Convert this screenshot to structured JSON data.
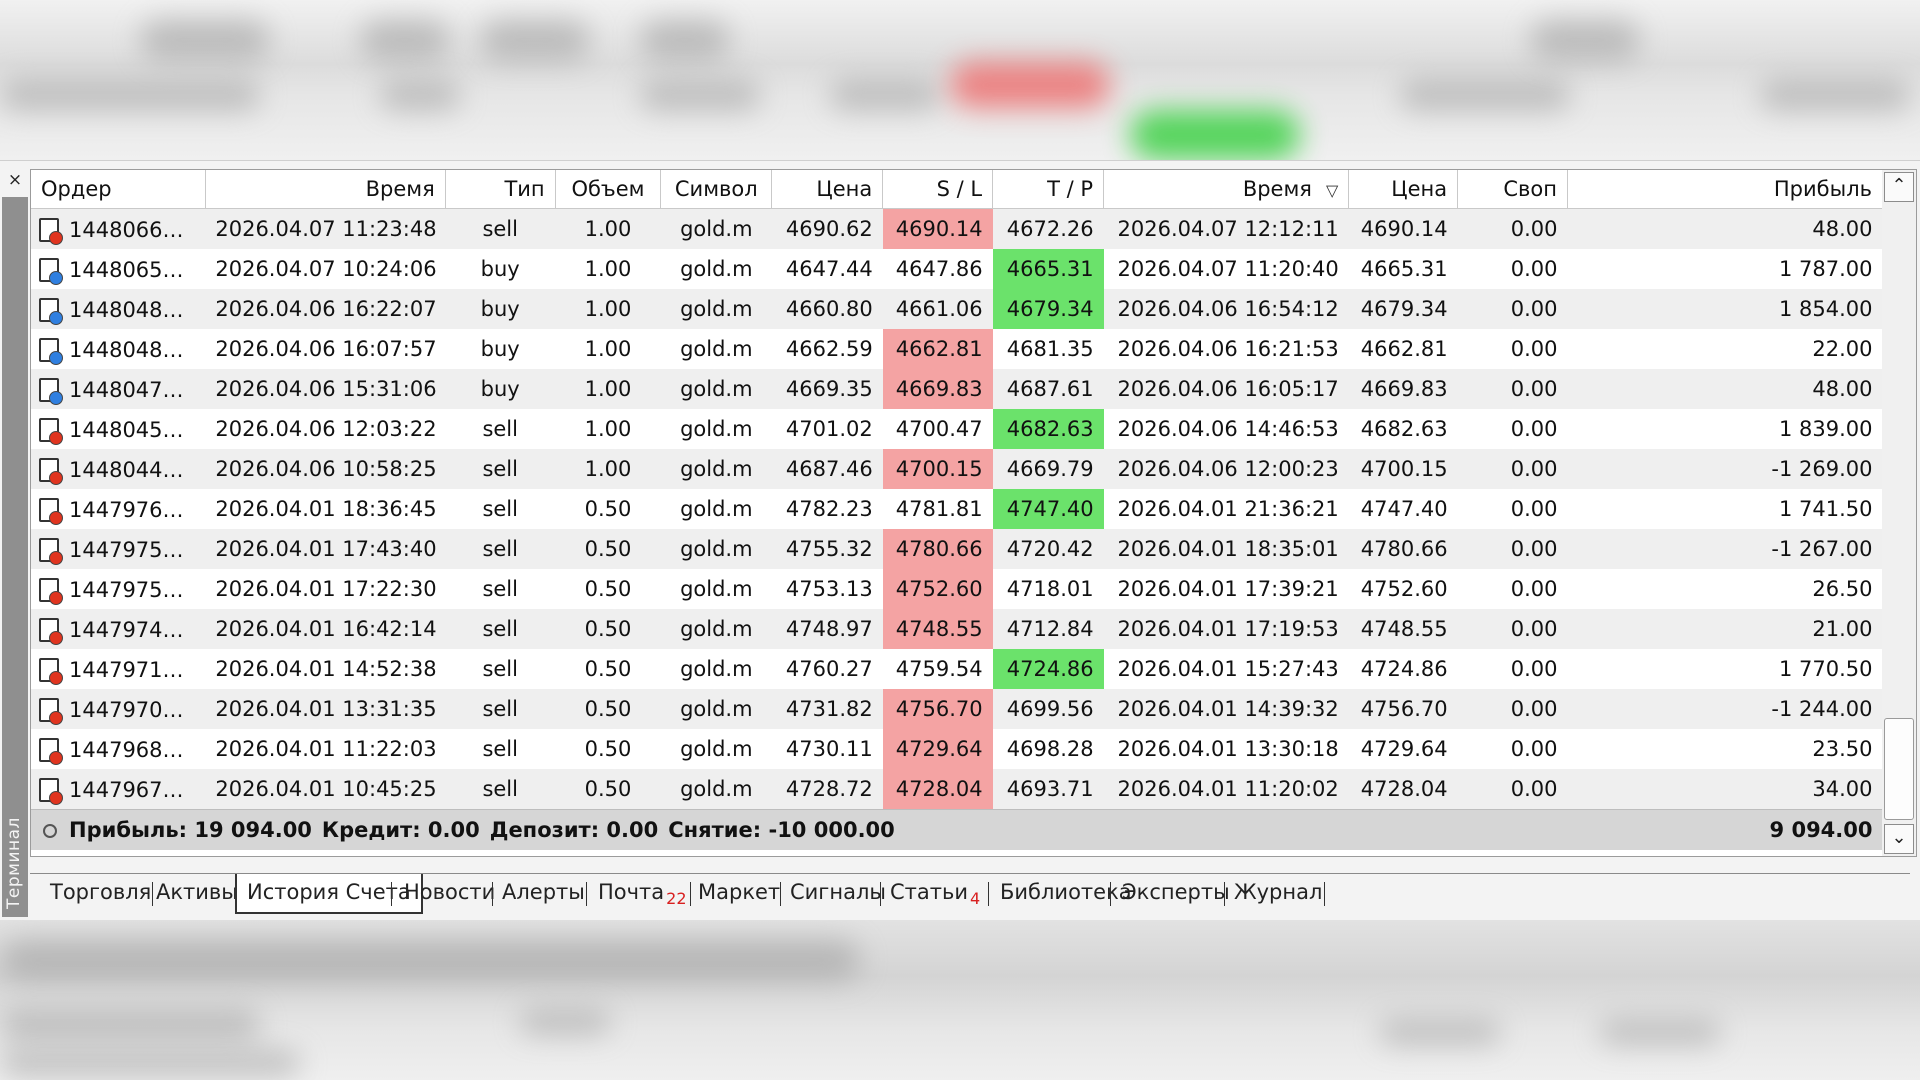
{
  "terminal": {
    "title": "Терминал",
    "close_glyph": "×"
  },
  "columns": [
    {
      "key": "order",
      "label": "Ордер"
    },
    {
      "key": "open_time",
      "label": "Время"
    },
    {
      "key": "type",
      "label": "Тип"
    },
    {
      "key": "volume",
      "label": "Объем"
    },
    {
      "key": "symbol",
      "label": "Символ"
    },
    {
      "key": "open_price",
      "label": "Цена"
    },
    {
      "key": "sl",
      "label": "S / L"
    },
    {
      "key": "tp",
      "label": "T / P"
    },
    {
      "key": "close_time",
      "label": "Время"
    },
    {
      "key": "close_price",
      "label": "Цена"
    },
    {
      "key": "swap",
      "label": "Своп"
    },
    {
      "key": "profit",
      "label": "Прибыль"
    }
  ],
  "sort_indicator": "▽",
  "rows": [
    {
      "order": "1448066…",
      "open_time": "2026.04.07 11:23:48",
      "type": "sell",
      "volume": "1.00",
      "symbol": "gold.m",
      "open_price": "4690.62",
      "sl": "4690.14",
      "tp": "4672.26",
      "close_time": "2026.04.07 12:12:11",
      "close_price": "4690.14",
      "swap": "0.00",
      "profit": "48.00",
      "hit": "sl"
    },
    {
      "order": "1448065…",
      "open_time": "2026.04.07 10:24:06",
      "type": "buy",
      "volume": "1.00",
      "symbol": "gold.m",
      "open_price": "4647.44",
      "sl": "4647.86",
      "tp": "4665.31",
      "close_time": "2026.04.07 11:20:40",
      "close_price": "4665.31",
      "swap": "0.00",
      "profit": "1 787.00",
      "hit": "tp"
    },
    {
      "order": "1448048…",
      "open_time": "2026.04.06 16:22:07",
      "type": "buy",
      "volume": "1.00",
      "symbol": "gold.m",
      "open_price": "4660.80",
      "sl": "4661.06",
      "tp": "4679.34",
      "close_time": "2026.04.06 16:54:12",
      "close_price": "4679.34",
      "swap": "0.00",
      "profit": "1 854.00",
      "hit": "tp"
    },
    {
      "order": "1448048…",
      "open_time": "2026.04.06 16:07:57",
      "type": "buy",
      "volume": "1.00",
      "symbol": "gold.m",
      "open_price": "4662.59",
      "sl": "4662.81",
      "tp": "4681.35",
      "close_time": "2026.04.06 16:21:53",
      "close_price": "4662.81",
      "swap": "0.00",
      "profit": "22.00",
      "hit": "sl"
    },
    {
      "order": "1448047…",
      "open_time": "2026.04.06 15:31:06",
      "type": "buy",
      "volume": "1.00",
      "symbol": "gold.m",
      "open_price": "4669.35",
      "sl": "4669.83",
      "tp": "4687.61",
      "close_time": "2026.04.06 16:05:17",
      "close_price": "4669.83",
      "swap": "0.00",
      "profit": "48.00",
      "hit": "sl"
    },
    {
      "order": "1448045…",
      "open_time": "2026.04.06 12:03:22",
      "type": "sell",
      "volume": "1.00",
      "symbol": "gold.m",
      "open_price": "4701.02",
      "sl": "4700.47",
      "tp": "4682.63",
      "close_time": "2026.04.06 14:46:53",
      "close_price": "4682.63",
      "swap": "0.00",
      "profit": "1 839.00",
      "hit": "tp"
    },
    {
      "order": "1448044…",
      "open_time": "2026.04.06 10:58:25",
      "type": "sell",
      "volume": "1.00",
      "symbol": "gold.m",
      "open_price": "4687.46",
      "sl": "4700.15",
      "tp": "4669.79",
      "close_time": "2026.04.06 12:00:23",
      "close_price": "4700.15",
      "swap": "0.00",
      "profit": "-1 269.00",
      "hit": "sl"
    },
    {
      "order": "1447976…",
      "open_time": "2026.04.01 18:36:45",
      "type": "sell",
      "volume": "0.50",
      "symbol": "gold.m",
      "open_price": "4782.23",
      "sl": "4781.81",
      "tp": "4747.40",
      "close_time": "2026.04.01 21:36:21",
      "close_price": "4747.40",
      "swap": "0.00",
      "profit": "1 741.50",
      "hit": "tp"
    },
    {
      "order": "1447975…",
      "open_time": "2026.04.01 17:43:40",
      "type": "sell",
      "volume": "0.50",
      "symbol": "gold.m",
      "open_price": "4755.32",
      "sl": "4780.66",
      "tp": "4720.42",
      "close_time": "2026.04.01 18:35:01",
      "close_price": "4780.66",
      "swap": "0.00",
      "profit": "-1 267.00",
      "hit": "sl"
    },
    {
      "order": "1447975…",
      "open_time": "2026.04.01 17:22:30",
      "type": "sell",
      "volume": "0.50",
      "symbol": "gold.m",
      "open_price": "4753.13",
      "sl": "4752.60",
      "tp": "4718.01",
      "close_time": "2026.04.01 17:39:21",
      "close_price": "4752.60",
      "swap": "0.00",
      "profit": "26.50",
      "hit": "sl"
    },
    {
      "order": "1447974…",
      "open_time": "2026.04.01 16:42:14",
      "type": "sell",
      "volume": "0.50",
      "symbol": "gold.m",
      "open_price": "4748.97",
      "sl": "4748.55",
      "tp": "4712.84",
      "close_time": "2026.04.01 17:19:53",
      "close_price": "4748.55",
      "swap": "0.00",
      "profit": "21.00",
      "hit": "sl"
    },
    {
      "order": "1447971…",
      "open_time": "2026.04.01 14:52:38",
      "type": "sell",
      "volume": "0.50",
      "symbol": "gold.m",
      "open_price": "4760.27",
      "sl": "4759.54",
      "tp": "4724.86",
      "close_time": "2026.04.01 15:27:43",
      "close_price": "4724.86",
      "swap": "0.00",
      "profit": "1 770.50",
      "hit": "tp"
    },
    {
      "order": "1447970…",
      "open_time": "2026.04.01 13:31:35",
      "type": "sell",
      "volume": "0.50",
      "symbol": "gold.m",
      "open_price": "4731.82",
      "sl": "4756.70",
      "tp": "4699.56",
      "close_time": "2026.04.01 14:39:32",
      "close_price": "4756.70",
      "swap": "0.00",
      "profit": "-1 244.00",
      "hit": "sl"
    },
    {
      "order": "1447968…",
      "open_time": "2026.04.01 11:22:03",
      "type": "sell",
      "volume": "0.50",
      "symbol": "gold.m",
      "open_price": "4730.11",
      "sl": "4729.64",
      "tp": "4698.28",
      "close_time": "2026.04.01 13:30:18",
      "close_price": "4729.64",
      "swap": "0.00",
      "profit": "23.50",
      "hit": "sl"
    },
    {
      "order": "1447967…",
      "open_time": "2026.04.01 10:45:25",
      "type": "sell",
      "volume": "0.50",
      "symbol": "gold.m",
      "open_price": "4728.72",
      "sl": "4728.04",
      "tp": "4693.71",
      "close_time": "2026.04.01 11:20:02",
      "close_price": "4728.04",
      "swap": "0.00",
      "profit": "34.00",
      "hit": "sl"
    }
  ],
  "summary": {
    "profit": "Прибыль: 19 094.00",
    "credit": "Кредит: 0.00",
    "deposit": "Депозит: 0.00",
    "withdrawal": "Снятие: -10 000.00",
    "total": "9 094.00"
  },
  "tabs": [
    {
      "label": "Торговля",
      "badge": ""
    },
    {
      "label": "Активы",
      "badge": ""
    },
    {
      "label": "История Счета",
      "badge": "",
      "active": true
    },
    {
      "label": "Новости",
      "badge": ""
    },
    {
      "label": "Алерты",
      "badge": ""
    },
    {
      "label": "Почта",
      "badge": "22"
    },
    {
      "label": "Маркет",
      "badge": ""
    },
    {
      "label": "Сигналы",
      "badge": ""
    },
    {
      "label": "Статьи",
      "badge": "4"
    },
    {
      "label": "Библиотека",
      "badge": ""
    },
    {
      "label": "Эксперты",
      "badge": ""
    },
    {
      "label": "Журнал",
      "badge": ""
    }
  ],
  "colors": {
    "sl_hit": "#f4a3a3",
    "tp_hit": "#6be26b",
    "sell_dot": "#e0341f",
    "buy_dot": "#2f7fe0",
    "badge": "#d81f1f"
  },
  "icons": {
    "sort": "sort-desc-icon",
    "order": "order-document-icon",
    "summary": "summary-circle-icon",
    "scroll_up": "chevron-up-icon",
    "scroll_down": "chevron-down-icon",
    "close": "close-icon"
  }
}
